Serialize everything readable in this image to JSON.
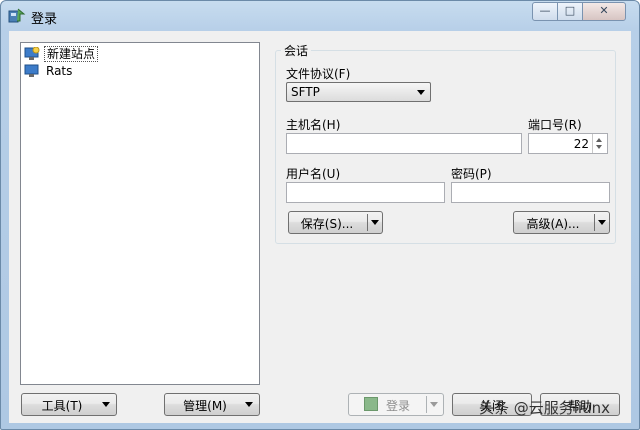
{
  "window": {
    "title": "登录",
    "min_glyph": "—",
    "max_glyph": "□",
    "close_glyph": "✕"
  },
  "sites": [
    {
      "label": "新建站点",
      "icon": "new-site-icon",
      "selected": true
    },
    {
      "label": "Rats",
      "icon": "monitor-icon",
      "selected": false
    }
  ],
  "session": {
    "group_title": "会话",
    "protocol_label": "文件协议(F)",
    "protocol_value": "SFTP",
    "host_label": "主机名(H)",
    "host_value": "",
    "port_label": "端口号(R)",
    "port_value": "22",
    "user_label": "用户名(U)",
    "user_value": "",
    "password_label": "密码(P)",
    "password_value": "",
    "save_button": "保存(S)...",
    "advanced_button": "高级(A)..."
  },
  "bottom": {
    "tools_button": "工具(T)",
    "manage_button": "管理(M)",
    "login_button": "登录",
    "close_button": "关闭",
    "help_button": "帮助"
  },
  "watermark": "头条 @云服务liunx",
  "colors": {
    "titlebar": "#b9d1ea",
    "client": "#f0f0f0",
    "accent": "#3a6ea5"
  }
}
